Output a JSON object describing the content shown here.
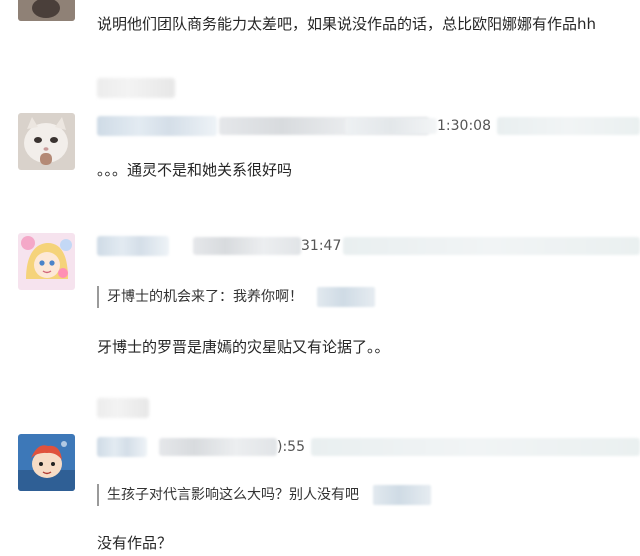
{
  "comments": [
    {
      "text": "说明他们团队商务能力太差吧，如果说没作品的话，总比欧阳娜娜有作品hh",
      "avatar_icon": "photo-avatar"
    },
    {
      "time_suffix": "1:30:08",
      "text": "。。。通灵不是和她关系很好吗",
      "avatar_icon": "cat-avatar"
    },
    {
      "time_suffix": "31:47",
      "quote": "牙博士的机会来了：我养你啊！",
      "text": "牙博士的罗晋是唐嫣的灾星贴又有论据了。。",
      "avatar_icon": "anime-girl-avatar"
    },
    {
      "time_suffix": "):55",
      "quote": "生孩子对代言影响这么大吗？别人没有吧",
      "text": "没有作品？",
      "avatar_icon": "ponyo-avatar"
    }
  ]
}
